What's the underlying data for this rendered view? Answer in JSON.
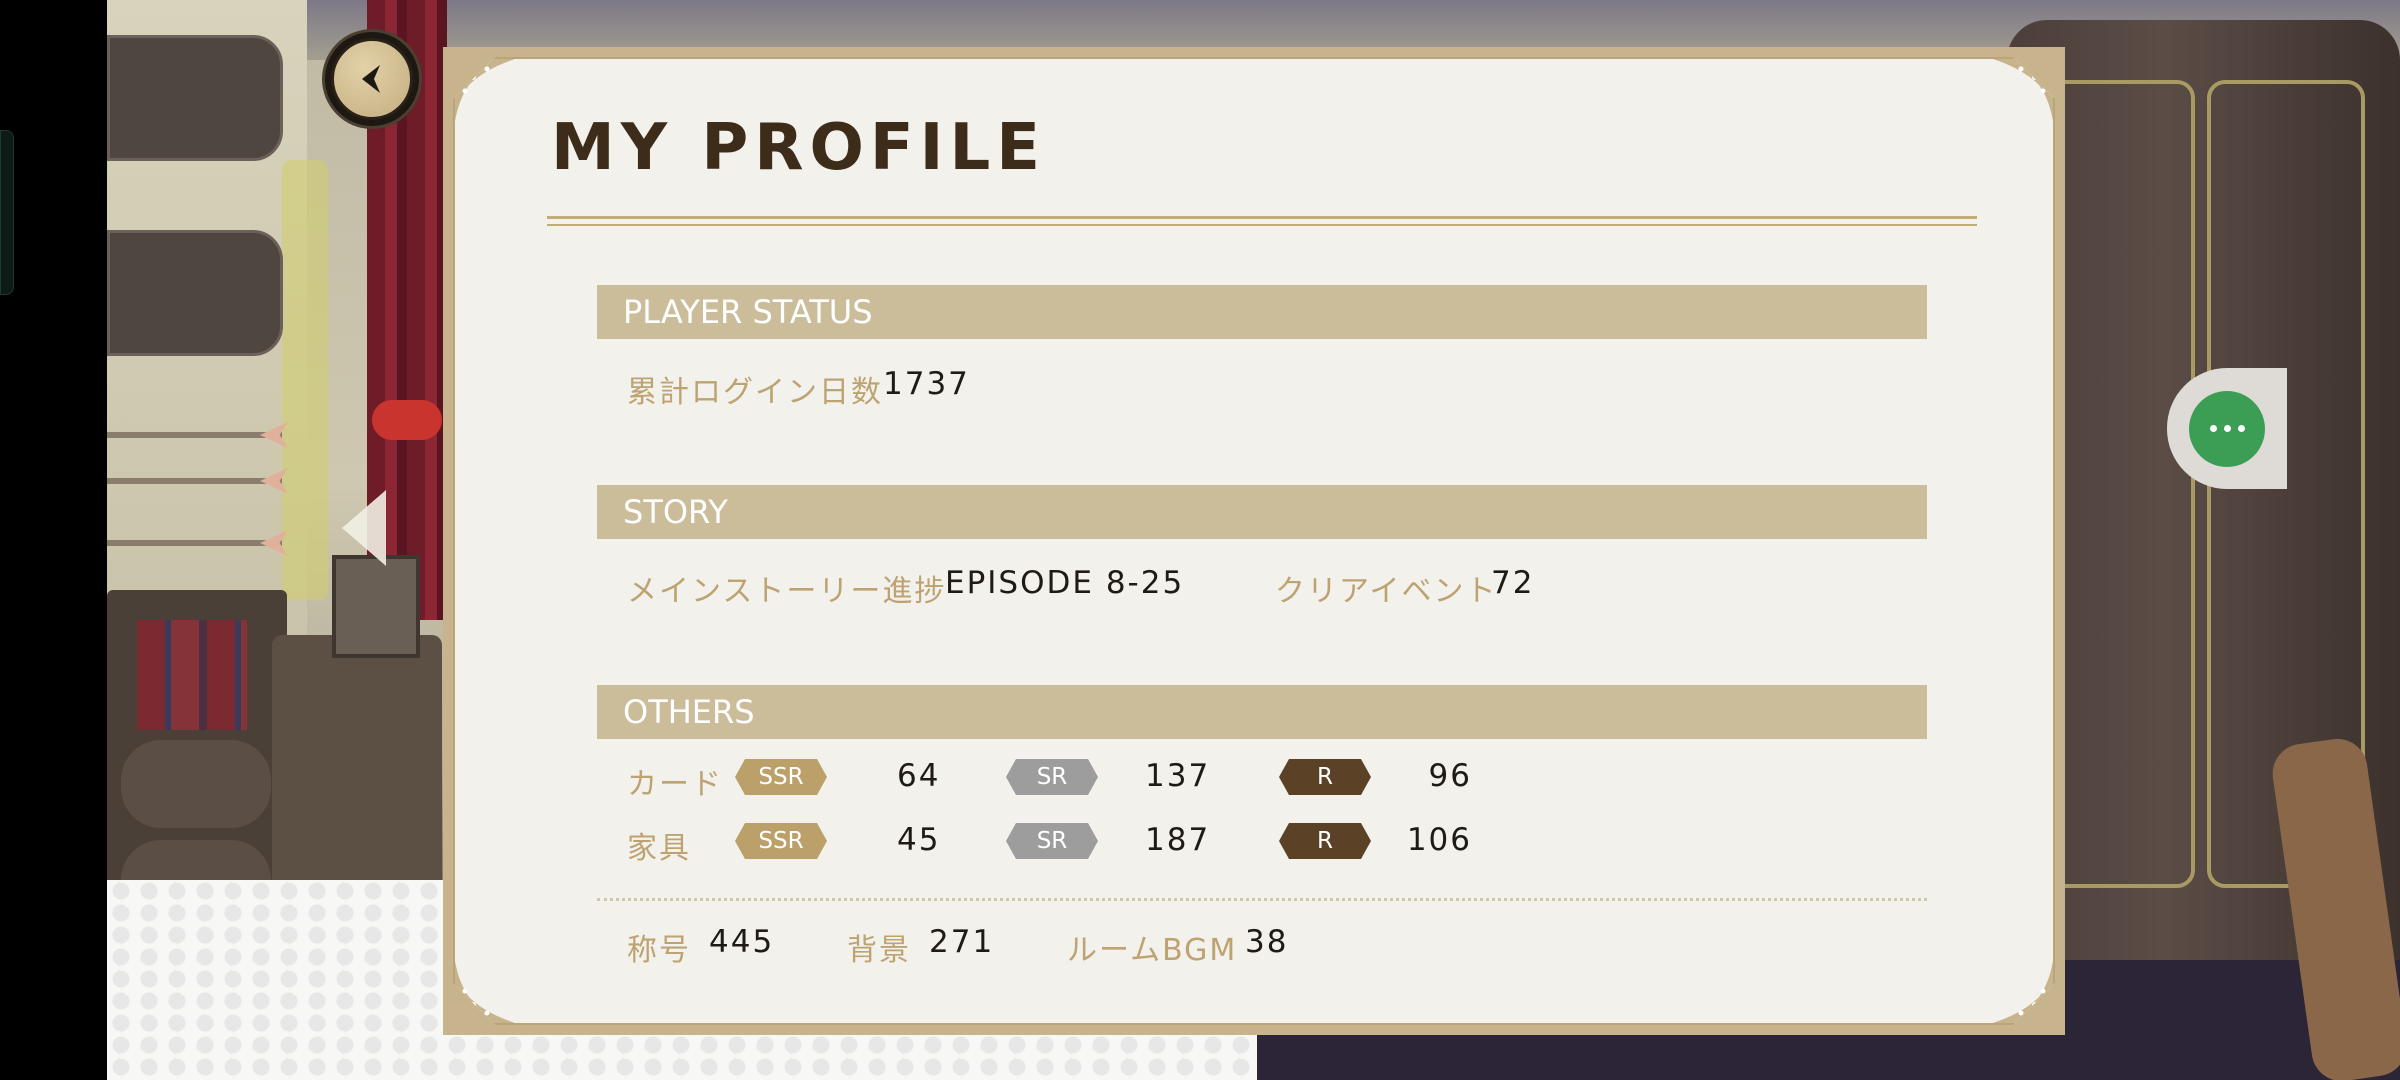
{
  "title": "MY PROFILE",
  "sections": {
    "player_status": {
      "header": "PLAYER STATUS",
      "login_days_label": "累計ログイン日数",
      "login_days_value": "1737"
    },
    "story": {
      "header": "STORY",
      "main_story_label": "メインストーリー進捗",
      "main_story_value": "EPISODE 8-25",
      "clear_event_label": "クリアイベント",
      "clear_event_value": "72"
    },
    "others": {
      "header": "OTHERS",
      "cards": {
        "label": "カード",
        "ssr_badge": "SSR",
        "ssr_value": "64",
        "sr_badge": "SR",
        "sr_value": "137",
        "r_badge": "R",
        "r_value": "96"
      },
      "furniture": {
        "label": "家具",
        "ssr_badge": "SSR",
        "ssr_value": "45",
        "sr_badge": "SR",
        "sr_value": "187",
        "r_badge": "R",
        "r_value": "106"
      },
      "titles_label": "称号",
      "titles_value": "445",
      "backgrounds_label": "背景",
      "backgrounds_value": "271",
      "room_bgm_label": "ルームBGM",
      "room_bgm_value": "38"
    }
  },
  "icons": {
    "back": "back-arrow-icon",
    "menu": "more-dots-icon",
    "prev": "left-chevron-icon"
  },
  "colors": {
    "header_bar": "#cbbc9a",
    "label_gold": "#bda372",
    "ssr": "#bca06a",
    "sr": "#9d9d9d",
    "r": "#5b4126",
    "float_button": "#3b9e54"
  }
}
